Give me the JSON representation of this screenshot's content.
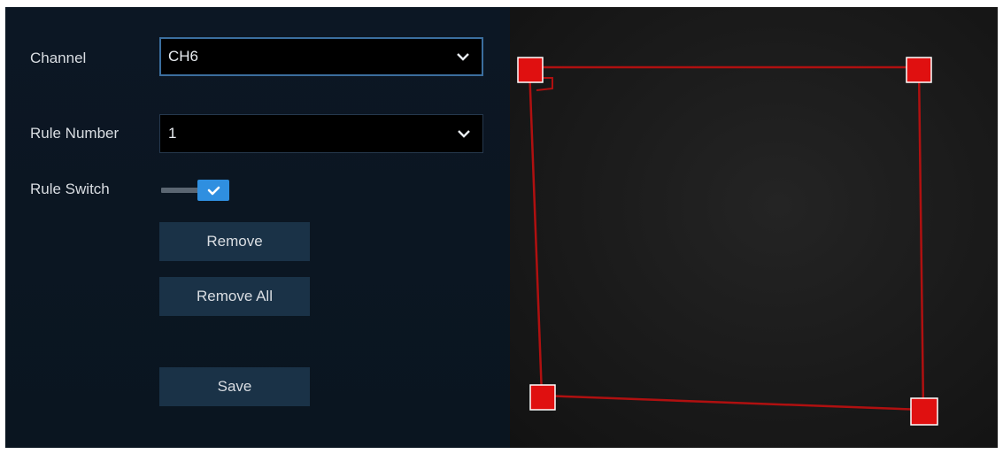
{
  "channel": {
    "label": "Channel",
    "value": "CH6"
  },
  "rule_number": {
    "label": "Rule Number",
    "value": "1"
  },
  "rule_switch": {
    "label": "Rule Switch",
    "enabled": true
  },
  "buttons": {
    "remove": "Remove",
    "remove_all": "Remove All",
    "save": "Save"
  },
  "icons": {
    "dropdown": "chevron-down-icon",
    "toggle_check": "check-icon"
  },
  "colors": {
    "panel_bg": "#0b1621",
    "button_bg": "#1a3247",
    "toggle_on": "#2f8fe0",
    "detection_area": "#b01010",
    "corner_handle": "#e01010"
  }
}
